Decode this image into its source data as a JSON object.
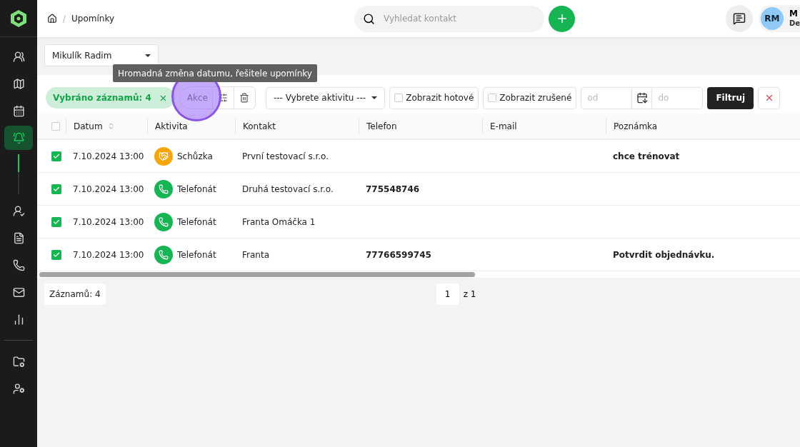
{
  "sidebar": {
    "items": [
      {
        "selected": false
      },
      {
        "selected": false
      },
      {
        "selected": false
      },
      {
        "selected": true
      },
      {
        "selected": false
      },
      {
        "selected": false
      },
      {
        "selected": false
      },
      {
        "selected": false
      },
      {
        "selected": false
      },
      {
        "selected": false
      },
      {
        "selected": false
      }
    ],
    "progress": {
      "level": 0.45
    }
  },
  "breadcrumb": {
    "separator": "/",
    "current": "Upomínky"
  },
  "search": {
    "placeholder": "Vyhledat kontakt"
  },
  "user": {
    "initials": "RM",
    "name": "M",
    "role": "De"
  },
  "owner_select": {
    "value": "Mikulík Radim"
  },
  "tooltip": "Hromadná změna datumu, řešitele upomínky",
  "toolbar": {
    "selected_chip": "Vybráno záznamů: 4",
    "actions_label": "Akce",
    "activity_select": "--- Vybrete aktivitu ---",
    "show_done": {
      "label": "Zobrazit hotové",
      "checked": false
    },
    "show_cancelled": {
      "label": "Zobrazit zrušené",
      "checked": false
    },
    "date_from": {
      "placeholder": "od"
    },
    "date_to": {
      "placeholder": "do"
    },
    "filter_button": "Filtruj"
  },
  "table": {
    "all_checked": false,
    "columns": [
      "Datum",
      "Aktivita",
      "Kontakt",
      "Telefon",
      "E-mail",
      "Poznámka"
    ],
    "rows": [
      {
        "checked": true,
        "date": "7.10.2024 13:00",
        "activity": {
          "kind": "meeting",
          "label": "Schůzka"
        },
        "contact": "První testovací s.r.o.",
        "phone": "",
        "email": "",
        "note": "chce trénovat"
      },
      {
        "checked": true,
        "date": "7.10.2024 13:00",
        "activity": {
          "kind": "call",
          "label": "Telefonát"
        },
        "contact": "Druhá testovací s.r.o.",
        "phone": "775548746",
        "email": "",
        "note": ""
      },
      {
        "checked": true,
        "date": "7.10.2024 13:00",
        "activity": {
          "kind": "call",
          "label": "Telefonát"
        },
        "contact": "Franta Omáčka 1",
        "phone": "",
        "email": "",
        "note": ""
      },
      {
        "checked": true,
        "date": "7.10.2024 13:00",
        "activity": {
          "kind": "call",
          "label": "Telefonát"
        },
        "contact": "Franta",
        "phone": "77766599745",
        "email": "",
        "note": "Potvrdit objednávku."
      }
    ]
  },
  "footer": {
    "count": "Záznamů: 4",
    "page": "1",
    "of": "z 1"
  }
}
